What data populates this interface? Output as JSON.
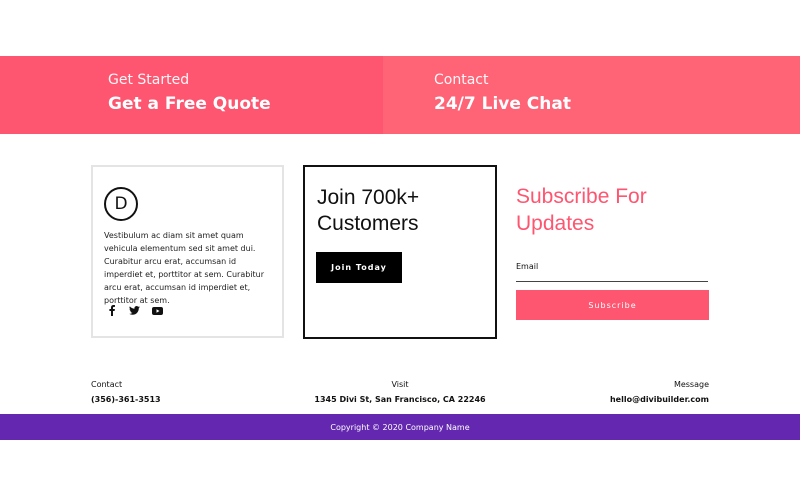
{
  "cta": {
    "left": {
      "eyebrow": "Get Started",
      "title": "Get a Free Quote",
      "color": "#fe5570"
    },
    "right": {
      "eyebrow": "Contact",
      "title": "24/7 Live Chat",
      "color": "#ff6376"
    }
  },
  "about": {
    "logo_letter": "D",
    "text": "Vestibulum ac diam sit amet quam vehicula elementum sed sit amet dui. Curabitur arcu erat, accumsan id imperdiet et, porttitor at sem. Curabitur arcu erat, accumsan id imperdiet et, porttitor at sem.",
    "social_icons": [
      "facebook-icon",
      "twitter-icon",
      "youtube-icon"
    ]
  },
  "join": {
    "title": "Join 700k+ Customers",
    "button": "Join Today"
  },
  "subscribe": {
    "title": "Subscribe For Updates",
    "email_label": "Email",
    "email_value": "",
    "button": "Subscribe",
    "accent": "#fe5570"
  },
  "info": {
    "contact": {
      "label": "Contact",
      "value": "(356)-361-3513"
    },
    "visit": {
      "label": "Visit",
      "value": "1345 Divi St, San Francisco, CA 22246"
    },
    "message": {
      "label": "Message",
      "value": "hello@divibuilder.com"
    }
  },
  "footer": {
    "copyright": "Copyright © 2020 Company Name",
    "color": "#6428b0"
  }
}
